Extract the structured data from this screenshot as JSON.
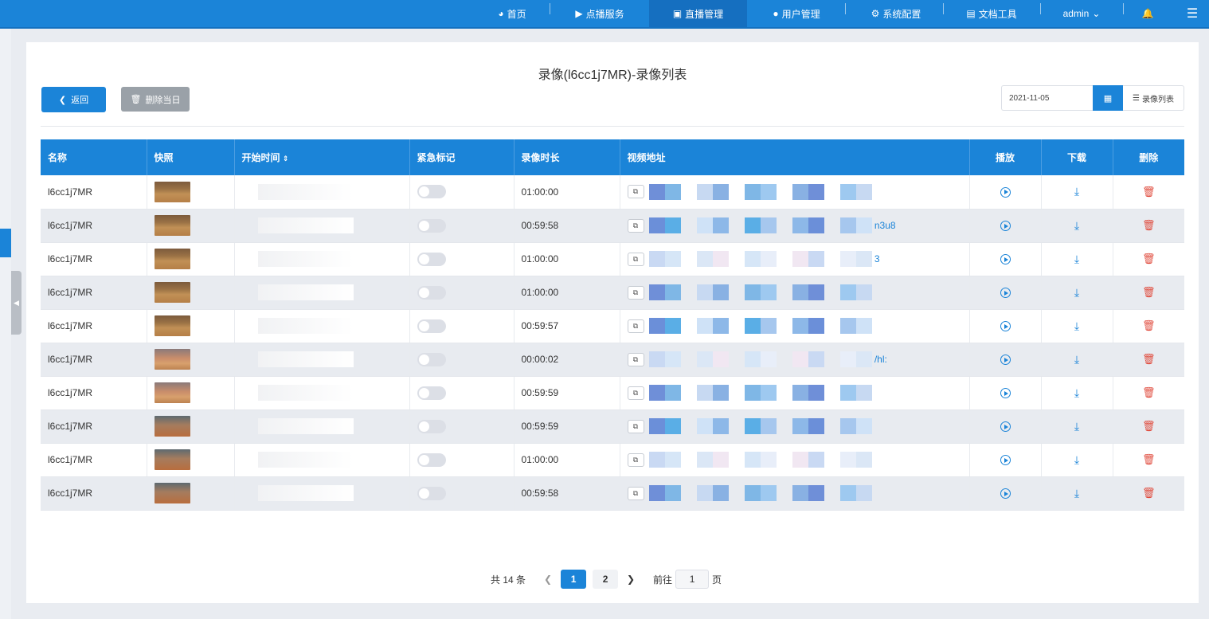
{
  "nav": {
    "items": [
      {
        "label": "首页",
        "icon": "dashboard-icon"
      },
      {
        "label": "点播服务",
        "icon": "video-icon"
      },
      {
        "label": "直播管理",
        "icon": "live-icon",
        "active": true
      },
      {
        "label": "用户管理",
        "icon": "user-icon"
      },
      {
        "label": "系统配置",
        "icon": "gear-icon"
      },
      {
        "label": "文档工具",
        "icon": "doc-icon"
      }
    ],
    "user": "admin",
    "colors": {
      "primary": "#1b84d8",
      "danger": "#e04a3c"
    }
  },
  "page": {
    "title": "录像(l6cc1j7MR)-录像列表",
    "back_label": "返回",
    "delete_day_label": "删除当日",
    "date_value": "2021-11-05",
    "list_label": "录像列表"
  },
  "table": {
    "headers": {
      "name": "名称",
      "snapshot": "快照",
      "start_time": "开始时间",
      "urgent": "紧急标记",
      "duration": "录像时长",
      "url": "视频地址",
      "play": "播放",
      "download": "下载",
      "delete": "删除"
    },
    "rows": [
      {
        "name": "l6cc1j7MR",
        "duration": "01:00:00",
        "url_tail": ""
      },
      {
        "name": "l6cc1j7MR",
        "duration": "00:59:58",
        "url_tail": "n3u8"
      },
      {
        "name": "l6cc1j7MR",
        "duration": "01:00:00",
        "url_tail": "3"
      },
      {
        "name": "l6cc1j7MR",
        "duration": "01:00:00",
        "url_tail": ""
      },
      {
        "name": "l6cc1j7MR",
        "duration": "00:59:57",
        "url_tail": ""
      },
      {
        "name": "l6cc1j7MR",
        "duration": "00:00:02",
        "url_tail": "/hl:"
      },
      {
        "name": "l6cc1j7MR",
        "duration": "00:59:59",
        "url_tail": ""
      },
      {
        "name": "l6cc1j7MR",
        "duration": "00:59:59",
        "url_tail": ""
      },
      {
        "name": "l6cc1j7MR",
        "duration": "01:00:00",
        "url_tail": ""
      },
      {
        "name": "l6cc1j7MR",
        "duration": "00:59:58",
        "url_tail": ""
      }
    ]
  },
  "pagination": {
    "total": "共 14 条",
    "pages": [
      "1",
      "2"
    ],
    "current": "1",
    "goto_prefix": "前往",
    "goto_value": "1",
    "goto_suffix": "页"
  }
}
